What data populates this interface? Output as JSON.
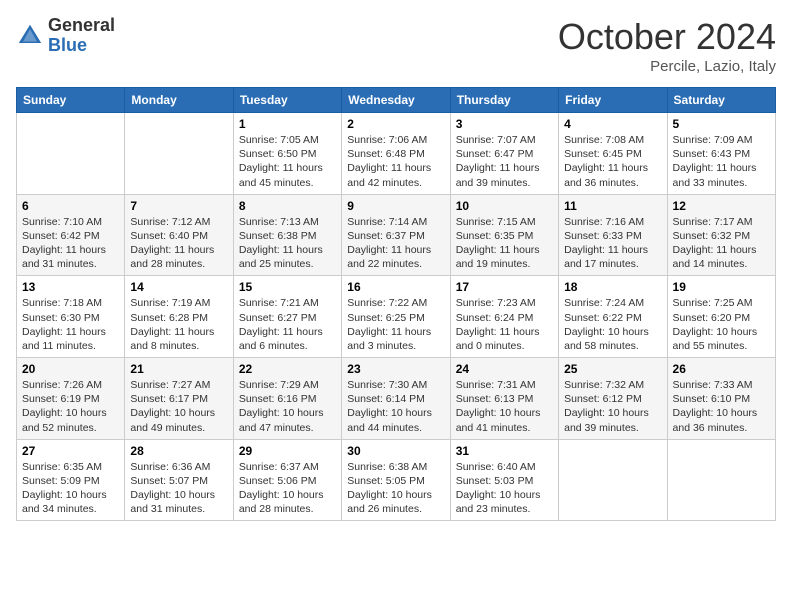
{
  "logo": {
    "general": "General",
    "blue": "Blue"
  },
  "title": "October 2024",
  "location": "Percile, Lazio, Italy",
  "weekdays": [
    "Sunday",
    "Monday",
    "Tuesday",
    "Wednesday",
    "Thursday",
    "Friday",
    "Saturday"
  ],
  "weeks": [
    [
      {
        "day": "",
        "info": ""
      },
      {
        "day": "",
        "info": ""
      },
      {
        "day": "1",
        "info": "Sunrise: 7:05 AM\nSunset: 6:50 PM\nDaylight: 11 hours and 45 minutes."
      },
      {
        "day": "2",
        "info": "Sunrise: 7:06 AM\nSunset: 6:48 PM\nDaylight: 11 hours and 42 minutes."
      },
      {
        "day": "3",
        "info": "Sunrise: 7:07 AM\nSunset: 6:47 PM\nDaylight: 11 hours and 39 minutes."
      },
      {
        "day": "4",
        "info": "Sunrise: 7:08 AM\nSunset: 6:45 PM\nDaylight: 11 hours and 36 minutes."
      },
      {
        "day": "5",
        "info": "Sunrise: 7:09 AM\nSunset: 6:43 PM\nDaylight: 11 hours and 33 minutes."
      }
    ],
    [
      {
        "day": "6",
        "info": "Sunrise: 7:10 AM\nSunset: 6:42 PM\nDaylight: 11 hours and 31 minutes."
      },
      {
        "day": "7",
        "info": "Sunrise: 7:12 AM\nSunset: 6:40 PM\nDaylight: 11 hours and 28 minutes."
      },
      {
        "day": "8",
        "info": "Sunrise: 7:13 AM\nSunset: 6:38 PM\nDaylight: 11 hours and 25 minutes."
      },
      {
        "day": "9",
        "info": "Sunrise: 7:14 AM\nSunset: 6:37 PM\nDaylight: 11 hours and 22 minutes."
      },
      {
        "day": "10",
        "info": "Sunrise: 7:15 AM\nSunset: 6:35 PM\nDaylight: 11 hours and 19 minutes."
      },
      {
        "day": "11",
        "info": "Sunrise: 7:16 AM\nSunset: 6:33 PM\nDaylight: 11 hours and 17 minutes."
      },
      {
        "day": "12",
        "info": "Sunrise: 7:17 AM\nSunset: 6:32 PM\nDaylight: 11 hours and 14 minutes."
      }
    ],
    [
      {
        "day": "13",
        "info": "Sunrise: 7:18 AM\nSunset: 6:30 PM\nDaylight: 11 hours and 11 minutes."
      },
      {
        "day": "14",
        "info": "Sunrise: 7:19 AM\nSunset: 6:28 PM\nDaylight: 11 hours and 8 minutes."
      },
      {
        "day": "15",
        "info": "Sunrise: 7:21 AM\nSunset: 6:27 PM\nDaylight: 11 hours and 6 minutes."
      },
      {
        "day": "16",
        "info": "Sunrise: 7:22 AM\nSunset: 6:25 PM\nDaylight: 11 hours and 3 minutes."
      },
      {
        "day": "17",
        "info": "Sunrise: 7:23 AM\nSunset: 6:24 PM\nDaylight: 11 hours and 0 minutes."
      },
      {
        "day": "18",
        "info": "Sunrise: 7:24 AM\nSunset: 6:22 PM\nDaylight: 10 hours and 58 minutes."
      },
      {
        "day": "19",
        "info": "Sunrise: 7:25 AM\nSunset: 6:20 PM\nDaylight: 10 hours and 55 minutes."
      }
    ],
    [
      {
        "day": "20",
        "info": "Sunrise: 7:26 AM\nSunset: 6:19 PM\nDaylight: 10 hours and 52 minutes."
      },
      {
        "day": "21",
        "info": "Sunrise: 7:27 AM\nSunset: 6:17 PM\nDaylight: 10 hours and 49 minutes."
      },
      {
        "day": "22",
        "info": "Sunrise: 7:29 AM\nSunset: 6:16 PM\nDaylight: 10 hours and 47 minutes."
      },
      {
        "day": "23",
        "info": "Sunrise: 7:30 AM\nSunset: 6:14 PM\nDaylight: 10 hours and 44 minutes."
      },
      {
        "day": "24",
        "info": "Sunrise: 7:31 AM\nSunset: 6:13 PM\nDaylight: 10 hours and 41 minutes."
      },
      {
        "day": "25",
        "info": "Sunrise: 7:32 AM\nSunset: 6:12 PM\nDaylight: 10 hours and 39 minutes."
      },
      {
        "day": "26",
        "info": "Sunrise: 7:33 AM\nSunset: 6:10 PM\nDaylight: 10 hours and 36 minutes."
      }
    ],
    [
      {
        "day": "27",
        "info": "Sunrise: 6:35 AM\nSunset: 5:09 PM\nDaylight: 10 hours and 34 minutes."
      },
      {
        "day": "28",
        "info": "Sunrise: 6:36 AM\nSunset: 5:07 PM\nDaylight: 10 hours and 31 minutes."
      },
      {
        "day": "29",
        "info": "Sunrise: 6:37 AM\nSunset: 5:06 PM\nDaylight: 10 hours and 28 minutes."
      },
      {
        "day": "30",
        "info": "Sunrise: 6:38 AM\nSunset: 5:05 PM\nDaylight: 10 hours and 26 minutes."
      },
      {
        "day": "31",
        "info": "Sunrise: 6:40 AM\nSunset: 5:03 PM\nDaylight: 10 hours and 23 minutes."
      },
      {
        "day": "",
        "info": ""
      },
      {
        "day": "",
        "info": ""
      }
    ]
  ]
}
